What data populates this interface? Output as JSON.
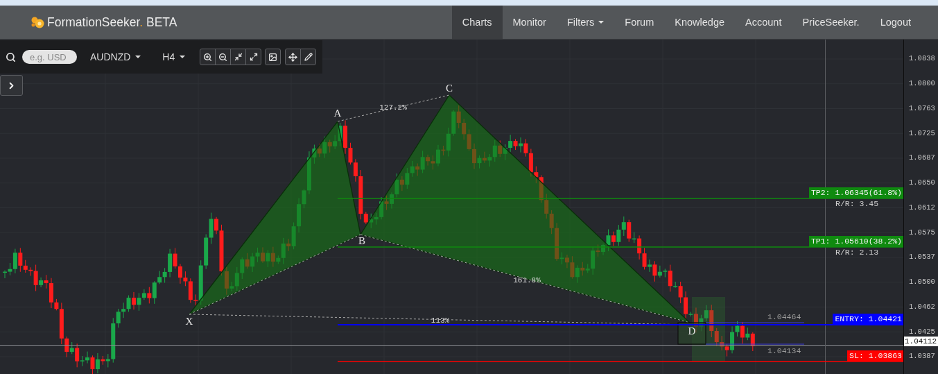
{
  "nav": {
    "brand": {
      "name": "FormationSeeker",
      "dot": ".",
      "tag": "BETA"
    },
    "items": [
      {
        "label": "Charts",
        "selected": true,
        "dropdown": false
      },
      {
        "label": "Monitor",
        "selected": false,
        "dropdown": false
      },
      {
        "label": "Filters",
        "selected": false,
        "dropdown": true
      },
      {
        "label": "Forum",
        "selected": false,
        "dropdown": false
      },
      {
        "label": "Knowledge",
        "selected": false,
        "dropdown": false
      },
      {
        "label": "Account",
        "selected": false,
        "dropdown": false
      },
      {
        "label": "PriceSeeker.",
        "selected": false,
        "dropdown": false
      },
      {
        "label": "Logout",
        "selected": false,
        "dropdown": false
      }
    ]
  },
  "toolbar": {
    "search": {
      "placeholder": "e.g. USD"
    },
    "symbol": "AUDNZD",
    "timeframe": "H4"
  },
  "chart": {
    "pattern": {
      "points": [
        "X",
        "A",
        "B",
        "C",
        "D"
      ],
      "ratios": [
        "127.2%",
        "161.8%",
        "113%"
      ]
    },
    "levels": [
      {
        "label": "TP2: 1.06345(61.8%)",
        "rr": "R/R: 3.45",
        "color": "#0f8a0f"
      },
      {
        "label": "TP1: 1.05610(38.2%)",
        "rr": "R/R: 2.13",
        "color": "#0f8a0f"
      },
      {
        "label": "ENTRY: 1.04421",
        "color": "#0000ff"
      },
      {
        "label": "SL: 1.03863",
        "color": "#ff0000"
      }
    ],
    "zone_levels": [
      "1.04464",
      "1.04134"
    ],
    "current_price": "1.04112",
    "price_axis": [
      "1.0838",
      "1.0800",
      "1.0763",
      "1.0725",
      "1.0687",
      "1.0650",
      "1.0612",
      "1.0575",
      "1.0537",
      "1.0500",
      "1.0462",
      "1.0425",
      "1.0387"
    ]
  }
}
